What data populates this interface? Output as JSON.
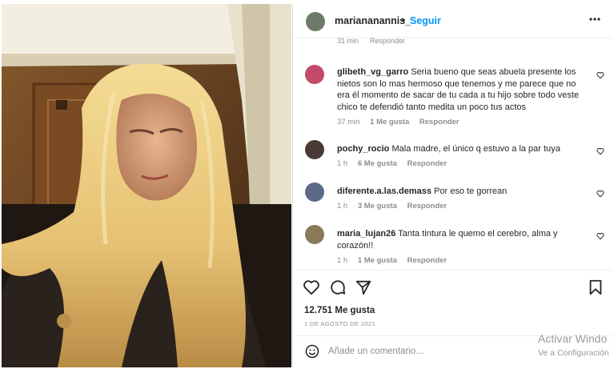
{
  "post": {
    "username": "mariananannis_",
    "follow_label": "Seguir",
    "dot": "•",
    "likes": "12.751 Me gusta",
    "date": "1 DE AGOSTO DE 2021",
    "add_comment_placeholder": "Añade un comentario..."
  },
  "partial_comment": {
    "time": "31 min",
    "reply": "Responder"
  },
  "comments": [
    {
      "user": "glibeth_vg_garro",
      "text": "Seria bueno que seas abuela presente los nietos son lo mas hermoso que tenemos y me parece que no era él momento de sacar de tu cada a tu hijo sobre todo veste chico te defendió tanto medita un poco tus actos",
      "time": "37 min",
      "likes": "1 Me gusta",
      "reply": "Responder"
    },
    {
      "user": "pochy_rocio",
      "text": "Mala madre, el único q estuvo a la par tuya",
      "time": "1 h",
      "likes": "6 Me gusta",
      "reply": "Responder"
    },
    {
      "user": "diferente.a.las.demass",
      "text": "Por eso te gorrean",
      "time": "1 h",
      "likes": "3 Me gusta",
      "reply": "Responder"
    },
    {
      "user": "maria_lujan26",
      "text": "Tanta tintura le quemo el cerebro, alma y corazón!!",
      "time": "1 h",
      "likes": "1 Me gusta",
      "reply": "Responder"
    }
  ],
  "watermark": {
    "line1": "Activar Windo",
    "line2": "Ve a Configuración"
  },
  "icons": [
    "more-options-icon",
    "heart-icon",
    "comment-icon",
    "share-icon",
    "bookmark-icon",
    "emoji-icon"
  ],
  "colors": {
    "link_blue": "#0095f6",
    "text": "#262626",
    "muted": "#8e8e8e",
    "border": "#dbdbdb"
  }
}
